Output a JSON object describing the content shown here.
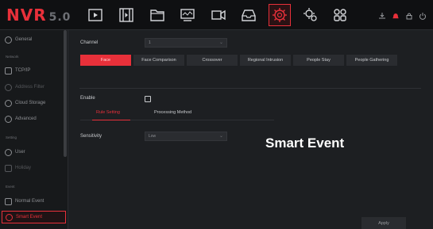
{
  "app": {
    "logo": "NVR",
    "version": "5.0"
  },
  "topbar": {
    "icons": [
      "playback-icon",
      "film-icon",
      "folder-icon",
      "network-icon",
      "camera-icon",
      "storage-icon",
      "ai-settings-icon",
      "system-settings-icon",
      "grid-icon"
    ],
    "active_icon": "ai-settings-icon",
    "status_icons": [
      "download-icon",
      "alarm-icon",
      "lock-icon",
      "power-icon"
    ],
    "accent": "#e8303a"
  },
  "sidebar": {
    "items": [
      {
        "label": "General",
        "icon": "gear-icon"
      },
      {
        "section": "Network"
      },
      {
        "label": "TCP/IP",
        "icon": "ip-icon"
      },
      {
        "label": "Address Filter",
        "icon": "filter-icon",
        "dim": true
      },
      {
        "label": "Cloud Storage",
        "icon": "cloud-icon"
      },
      {
        "label": "Advanced",
        "icon": "advanced-gear-icon"
      },
      {
        "section": "Setting"
      },
      {
        "label": "User",
        "icon": "user-icon"
      },
      {
        "label": "Holiday",
        "icon": "calendar-icon",
        "dim": true
      },
      {
        "section": "Event"
      },
      {
        "label": "Normal Event",
        "icon": "event-icon"
      },
      {
        "label": "Smart Event",
        "icon": "smart-event-icon",
        "active": true
      }
    ]
  },
  "main": {
    "channel_label": "Channel",
    "channel_value": "1",
    "tabs": [
      "Face",
      "Face Comparison",
      "Crossover",
      "Regional Intrusion",
      "People Stay",
      "People Gathering"
    ],
    "active_tab": "Face",
    "enable_label": "Enable",
    "subtabs": [
      "Rule Setting",
      "Processing Method"
    ],
    "active_subtab": "Rule Setting",
    "sensitivity_label": "Sensitivity",
    "sensitivity_value": "Low",
    "overlay_title": "Smart Event",
    "apply_label": "Apply"
  }
}
